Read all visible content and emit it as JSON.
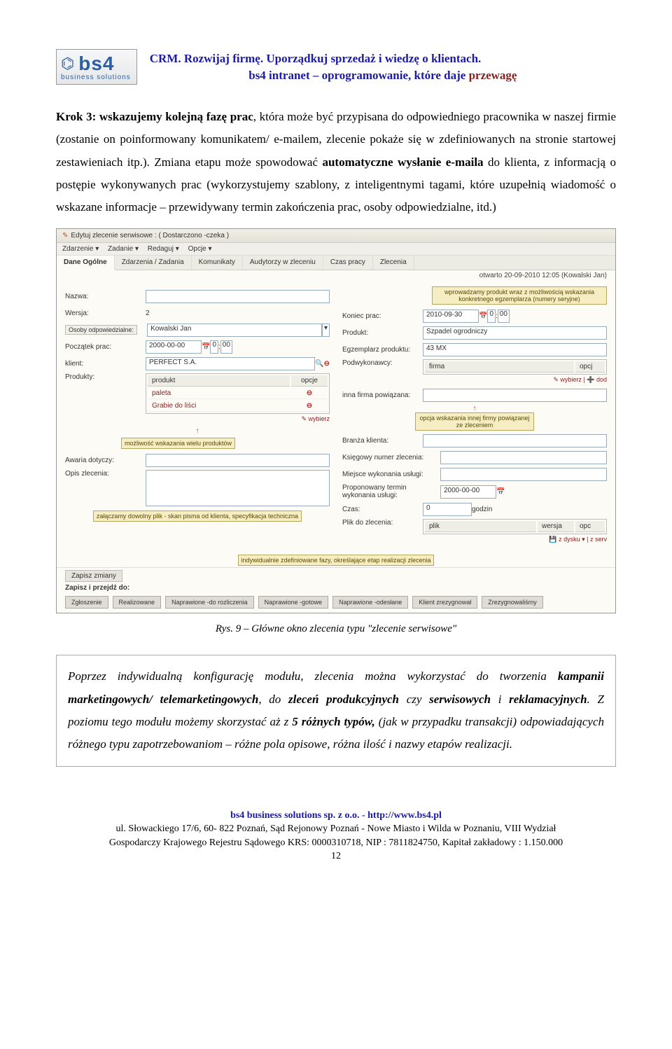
{
  "header": {
    "logo_text": "bs4",
    "logo_sub": "business solutions",
    "line1_a": "CRM. Rozwijaj firmę. Uporządkuj sprzedaż i wiedzę o klientach.",
    "line2_a": "bs4 intranet – oprogramowanie, które daje ",
    "line2_b": "przewagę"
  },
  "para1_a": "Krok 3: wskazujemy kolejną fazę prac",
  "para1_b": ", która może być przypisana do odpowiedniego pracownika w naszej firmie (zostanie on poinformowany komunikatem/ e-mailem, zlecenie pokaże się w zdefiniowanych na stronie startowej zestawieniach itp.). Zmiana etapu może spowodować ",
  "para1_c": "automatyczne wysłanie e-maila",
  "para1_d": " do klienta, z informacją o postępie wykonywanych prac (wykorzystujemy szablony, z inteligentnymi tagami, które uzupełnią wiadomość o wskazane informacje – przewidywany termin zakończenia prac, osoby odpowiedzialne, itd.)",
  "shot": {
    "title": "Edytuj zlecenie serwisowe : ( Dostarczono -czeka )",
    "menu": [
      "Zdarzenie ▾",
      "Zadanie ▾",
      "Redaguj ▾",
      "Opcje ▾"
    ],
    "tabs": [
      "Dane Ogólne",
      "Zdarzenia / Zadania",
      "Komunikaty",
      "Audytorzy w zleceniu",
      "Czas pracy",
      "Zlecenia"
    ],
    "status_opened": "otwarto 20-09-2010 12:05 (Kowalski Jan)",
    "left": {
      "nazwa": "Nazwa:",
      "wersja": "Wersja:",
      "wersja_v": "2",
      "osoby": "Osoby odpowiedzialne:",
      "osoby_v": "Kowalski Jan",
      "poczatek": "Początek prac:",
      "poczatek_v": "2000-00-00",
      "klient": "klient:",
      "klient_v": "PERFECT S.A.",
      "produkty": "Produkty:",
      "prod_h1": "produkt",
      "prod_h2": "opcje",
      "prod_r1": "paleta",
      "prod_r2": "Grabie do liści",
      "wybierz": "wybierz",
      "callout_prods": "możliwość wskazania wielu produktów",
      "awaria": "Awaria dotyczy:",
      "opis": "Opis zlecenia:",
      "callout_attach": "załączamy dowolny plik - skan pisma od klienta, specyfikacja techniczna",
      "callout_stages": "indywidualnie zdefiniowane fazy, określające etap realizacji zlecenia"
    },
    "right": {
      "callout_prod": "wprowadzamy produkt wraz z możliwością wskazania konkretnego egzemplarza (numery seryjne)",
      "koniec": "Koniec prac:",
      "koniec_v": "2010-09-30",
      "produkt": "Produkt:",
      "produkt_v": "Szpadel ogrodniczy",
      "egz": "Egzemplarz produktu:",
      "egz_v": "43 MX",
      "podwyk": "Podwykonawcy:",
      "podwyk_h1": "firma",
      "podwyk_h2": "opcj",
      "wybierz_dod": "wybierz | ➕ dod",
      "inna": "inna firma powiązana:",
      "callout_firm": "opcja wskazania innej firmy powiązanej ze zleceniem",
      "branza": "Branża klienta:",
      "ksieg": "Księgowy numer zlecenia:",
      "miejsce": "Miejsce wykonania usługi:",
      "prop": "Proponowany termin wykonania usługi:",
      "prop_v": "2000-00-00",
      "czas": "Czas:",
      "czas_v": "0",
      "czas_u": "godzin",
      "plik": "Plik do zlecenia:",
      "plik_h1": "plik",
      "plik_h2": "wersja",
      "plik_h3": "opc",
      "plik_action": "z dysku ▾ | z serv"
    },
    "save": "Zapisz zmiany",
    "go": "Zapisz i przejdź do:",
    "stages": [
      "Zgłoszenie",
      "Realizowane",
      "Naprawione -do rozliczenia",
      "Naprawione -gotowe",
      "Naprawione -odesłane",
      "Klient zrezygnował",
      "Zrezygnowaliśmy"
    ],
    "zero": "0",
    "hour": "00"
  },
  "caption": "Rys. 9 – Główne okno zlecenia typu \"zlecenie serwisowe\"",
  "config_a": "Poprzez indywidualną konfigurację modułu, zlecenia można wykorzystać do tworzenia ",
  "config_b": "kampanii marketingowych/ telemarketingowych",
  "config_c": ", do ",
  "config_d": "zleceń produkcyjnych",
  "config_e": " czy ",
  "config_f": "serwisowych",
  "config_g": " i ",
  "config_h": "reklamacyjnych",
  "config_i": ". Z poziomu tego modułu możemy skorzystać aż z ",
  "config_j": "5 różnych typów,",
  "config_k": " (jak w przypadku transakcji) odpowiadających różnego typu zapotrzebowaniom – różne pola opisowe, różna ilość i nazwy etapów realizacji.",
  "footer": {
    "f1": "bs4 business solutions sp. z o.o. - http://www.bs4.pl",
    "f2": "ul. Słowackiego 17/6, 60- 822 Poznań, Sąd Rejonowy Poznań - Nowe Miasto i Wilda w Poznaniu, VIII Wydział",
    "f3": "Gospodarczy Krajowego Rejestru Sądowego KRS: 0000310718, NIP : 7811824750, Kapitał zakładowy : 1.150.000",
    "page": "12"
  }
}
